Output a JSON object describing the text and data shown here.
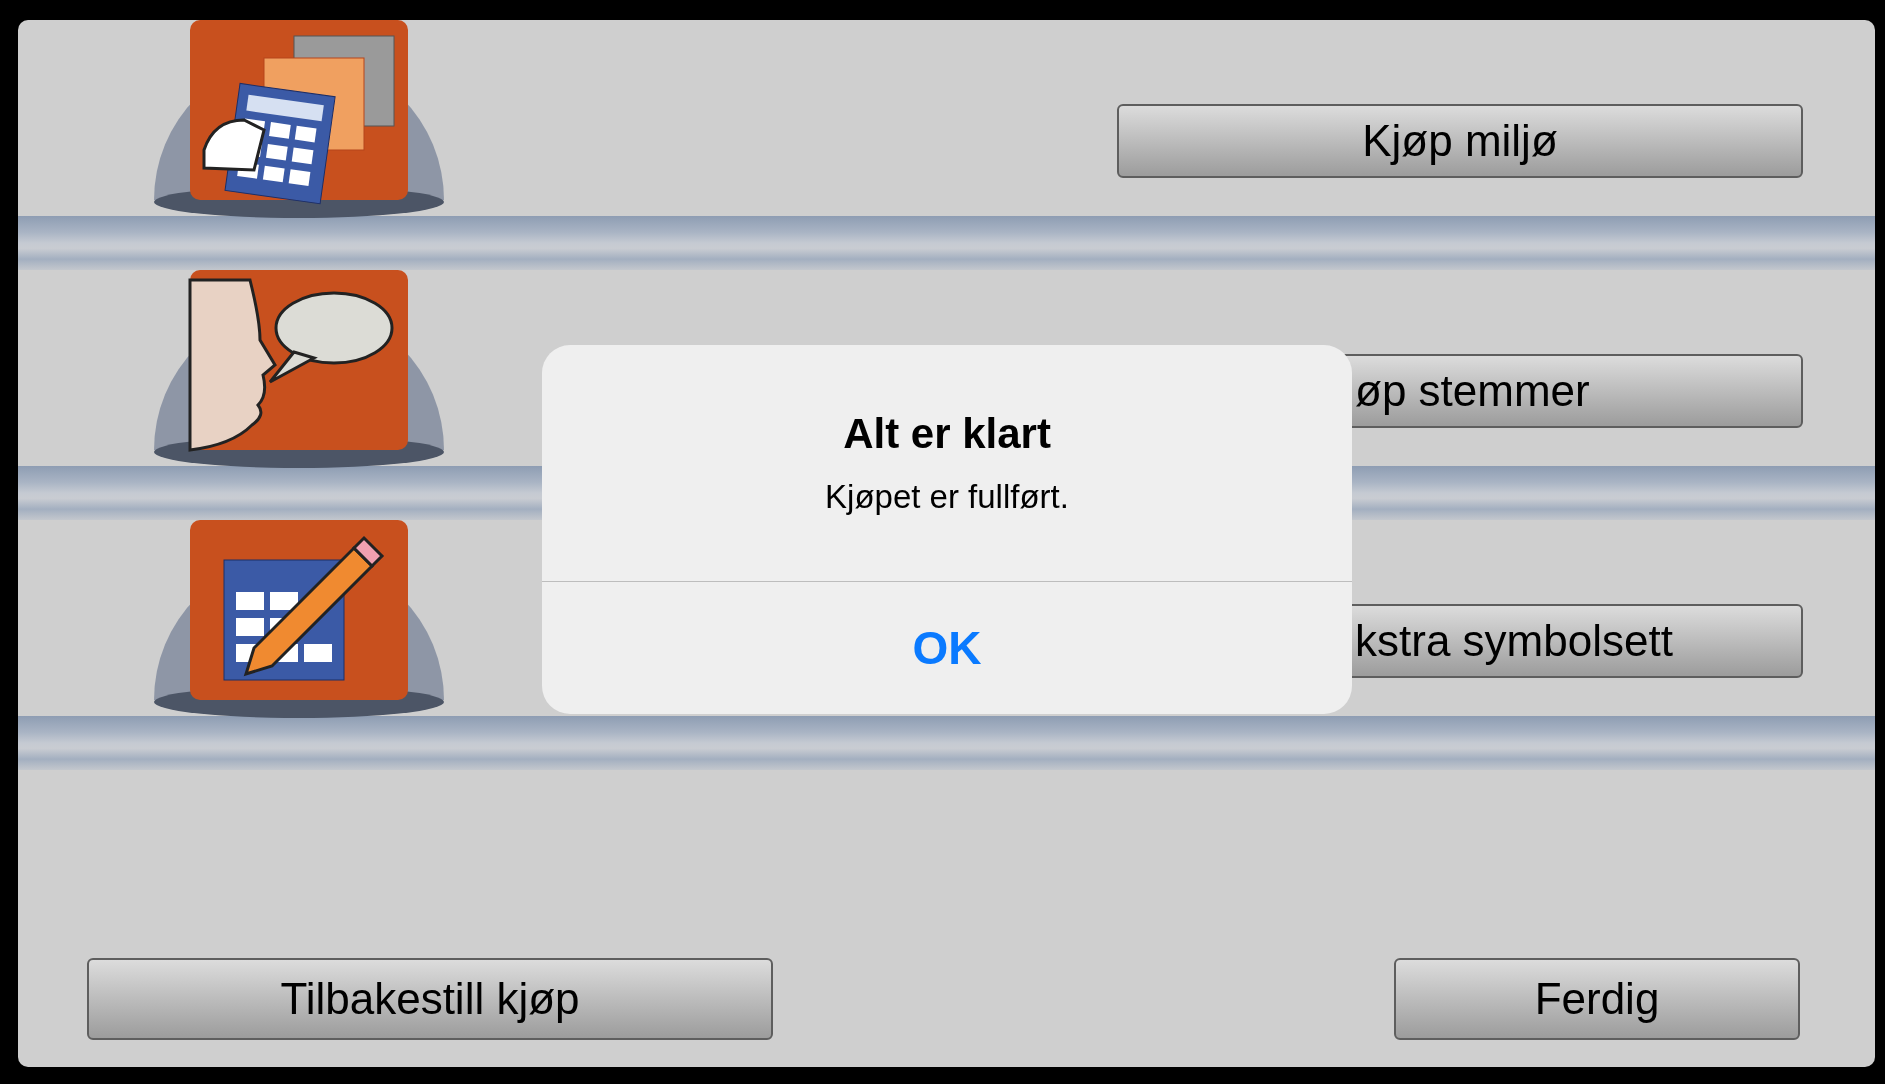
{
  "rows": [
    {
      "kind": "calculators",
      "button": "Kjøp miljø"
    },
    {
      "kind": "speaker",
      "button": "øp stemmer"
    },
    {
      "kind": "calculator-pencil",
      "button": "kstra symbolsett"
    }
  ],
  "footer_buttons": [
    "Tilbakestill kjøp",
    "Ferdig"
  ],
  "alert": {
    "title": "Alt er klart",
    "message": "Kjøpet er fullført.",
    "button": "OK"
  }
}
